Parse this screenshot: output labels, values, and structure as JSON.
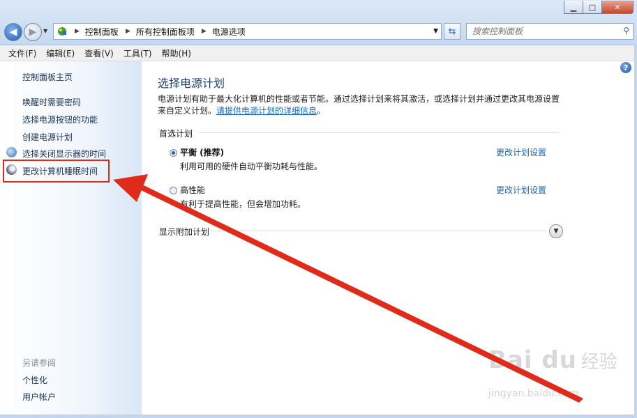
{
  "window": {
    "controls": {
      "minimize": "▁",
      "maximize": "□",
      "close": "✕"
    }
  },
  "address": {
    "crumbs": [
      "控制面板",
      "所有控制面板项",
      "电源选项"
    ],
    "search_placeholder": "搜索控制面板"
  },
  "menu": [
    "文件(F)",
    "编辑(E)",
    "查看(V)",
    "工具(T)",
    "帮助(H)"
  ],
  "sidebar": {
    "home": "控制面板主页",
    "links": [
      "唤醒时需要密码",
      "选择电源按钮的功能",
      "创建电源计划",
      "选择关闭显示器的时间",
      "更改计算机睡眠时间"
    ],
    "see_also_title": "另请参阅",
    "see_also": [
      "个性化",
      "用户帐户"
    ]
  },
  "main": {
    "title": "选择电源计划",
    "desc_line1": "电源计划有助于最大化计算机的性能或者节能。通过选择计划来将其激活，或选择计划并通过更改其电源设置",
    "desc_line2_prefix": "来自定义计划。",
    "desc_link": "请提供电源计划的详细信息",
    "desc_line2_suffix": "。",
    "preferred_header": "首选计划",
    "plans": [
      {
        "name": "平衡 (推荐)",
        "desc": "利用可用的硬件自动平衡功耗与性能。",
        "selected": true,
        "change": "更改计划设置"
      },
      {
        "name": "高性能",
        "desc": "有利于提高性能，但会增加功耗。",
        "selected": false,
        "change": "更改计划设置"
      }
    ],
    "more_plans": "显示附加计划",
    "help": "?"
  },
  "annotation": {
    "color": "#e02a1a"
  },
  "watermark": {
    "logo": "Bai du",
    "cn": "经验",
    "url": "jingyan.baidu.com"
  }
}
